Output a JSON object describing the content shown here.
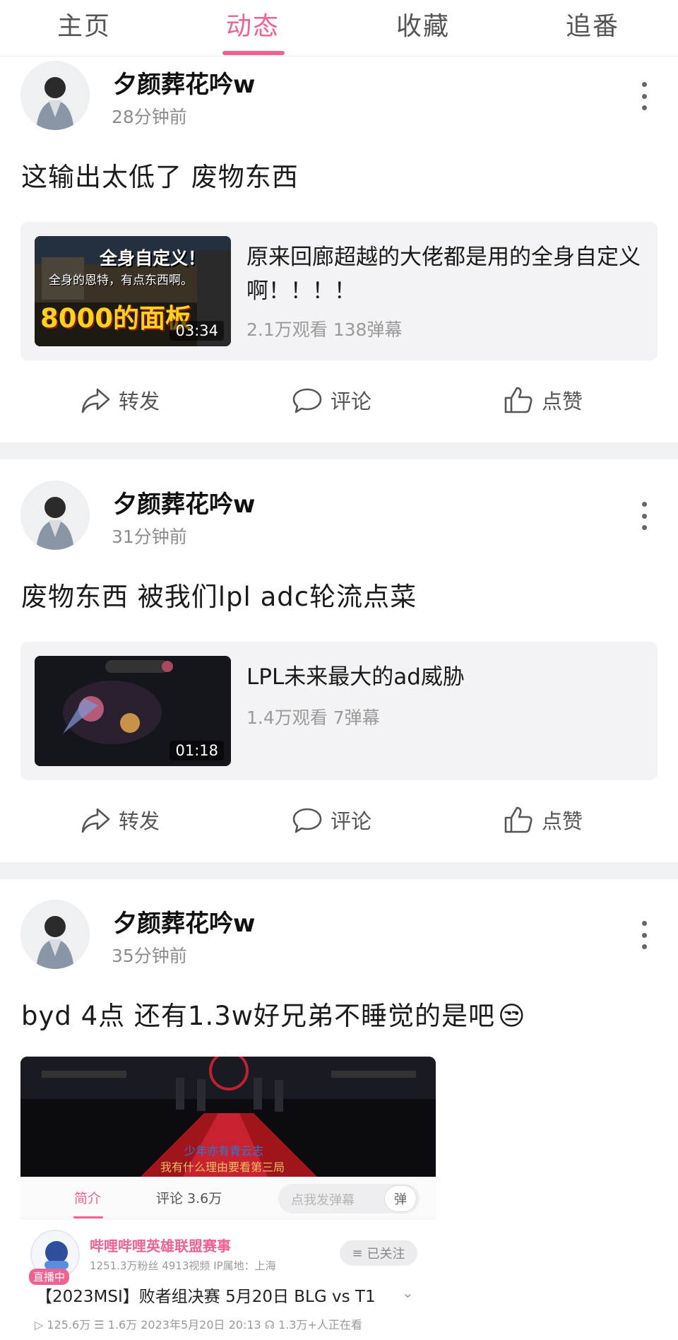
{
  "tabs": [
    {
      "label": "主页"
    },
    {
      "label": "动态"
    },
    {
      "label": "收藏"
    },
    {
      "label": "追番"
    }
  ],
  "active_tab": "动态",
  "colors": {
    "accent": "#f06292",
    "separator": "#f1f2f3",
    "card_bg": "#f3f3f5"
  },
  "posts": [
    {
      "author": "夕颜葬花吟w",
      "time": "28分钟前",
      "text": "这输出太低了 废物东西",
      "video": {
        "title": "原来回廊超越的大佬都是用的全身自定义啊！！！！",
        "duration": "03:34",
        "stats": "2.1万观看 138弹幕",
        "thumb_caption_1": "全身自定义！",
        "thumb_caption_2": "全身的恩特，有点东西啊。",
        "thumb_caption_3": "8000的面板"
      },
      "actions": {
        "share": "转发",
        "comment": "评论",
        "like": "点赞"
      }
    },
    {
      "author": "夕颜葬花吟w",
      "time": "31分钟前",
      "text": "废物东西 被我们lpl adc轮流点菜",
      "video": {
        "title": "LPL未来最大的ad威胁",
        "duration": "01:18",
        "stats": "1.4万观看 7弹幕"
      },
      "actions": {
        "share": "转发",
        "comment": "评论",
        "like": "点赞"
      }
    },
    {
      "author": "夕颜葬花吟w",
      "time": "35分钟前",
      "text": "byd  4点 还有1.3w好兄弟不睡觉的是吧",
      "emoji": "😒",
      "stream": {
        "subtitle_1": "少年亦有青云志",
        "subtitle_2": "我有什么理由要看第三局",
        "tab_intro": "简介",
        "tab_comments": "评论 3.6万",
        "danmaku_placeholder": "点我发弹幕",
        "danmaku_button": "弹",
        "live_badge": "直播中",
        "channel": "哔哩哔哩英雄联盟赛事",
        "channel_meta": "1251.3万粉丝   4913视频   IP属地：上海",
        "follow": "已关注",
        "title": "【2023MSI】败者组决赛 5月20日 BLG vs T1",
        "stats": "▷ 125.6万   ☰ 1.6万   2023年5月20日 20:13   ☊ 1.3万+人正在看"
      }
    }
  ]
}
